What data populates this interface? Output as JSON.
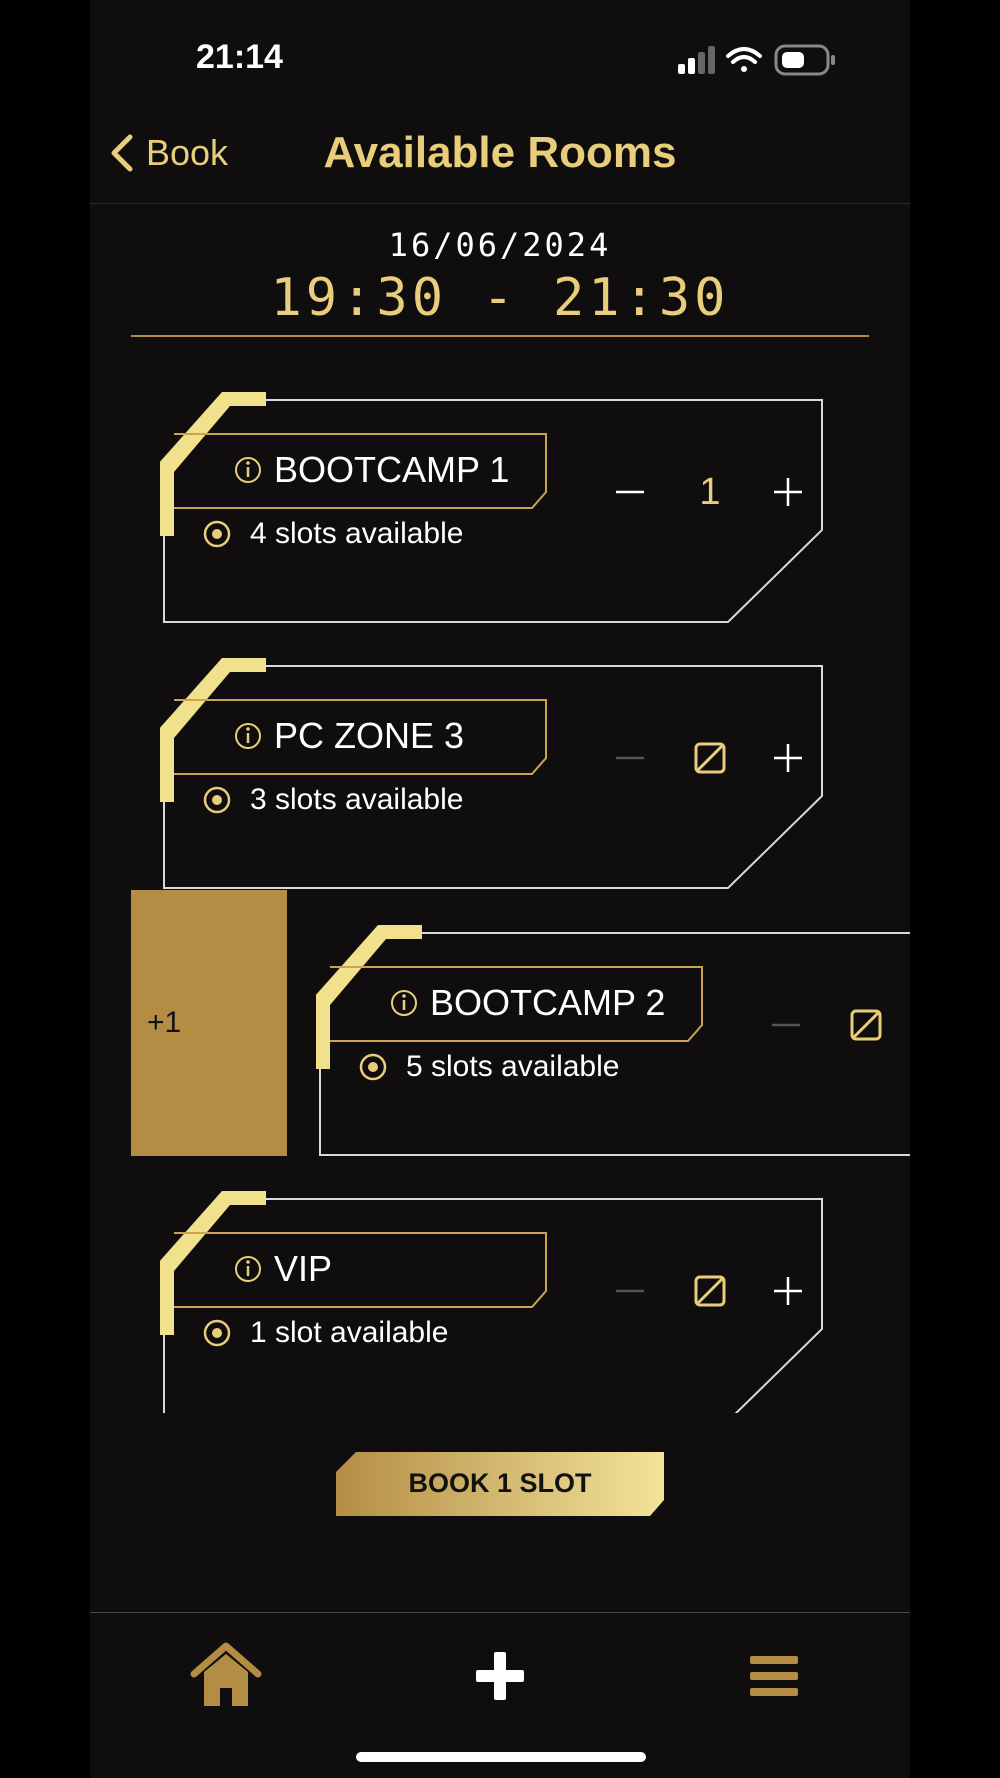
{
  "status_bar": {
    "time": "21:14"
  },
  "nav": {
    "back_label": "Book",
    "title": "Available Rooms"
  },
  "booking": {
    "date": "16/06/2024",
    "time_range": "19:30 - 21:30"
  },
  "rooms": [
    {
      "name": "BOOTCAMP 1",
      "slots": "4 slots available",
      "quantity": "1"
    },
    {
      "name": "PC ZONE 3",
      "slots": "3 slots available",
      "quantity": ""
    },
    {
      "name": "BOOTCAMP 2",
      "slots": "5 slots available",
      "quantity": ""
    },
    {
      "name": "VIP",
      "slots": "1 slot available",
      "quantity": ""
    }
  ],
  "swipe_action": {
    "label": "+1"
  },
  "book_button": {
    "label": "BOOK 1 SLOT"
  },
  "tab_bar": {
    "icons": [
      "home-icon",
      "plus-icon",
      "menu-icon"
    ]
  },
  "colors": {
    "gold": "#e8cd7a",
    "gold_dark": "#b48d45",
    "background": "#100d0f"
  }
}
